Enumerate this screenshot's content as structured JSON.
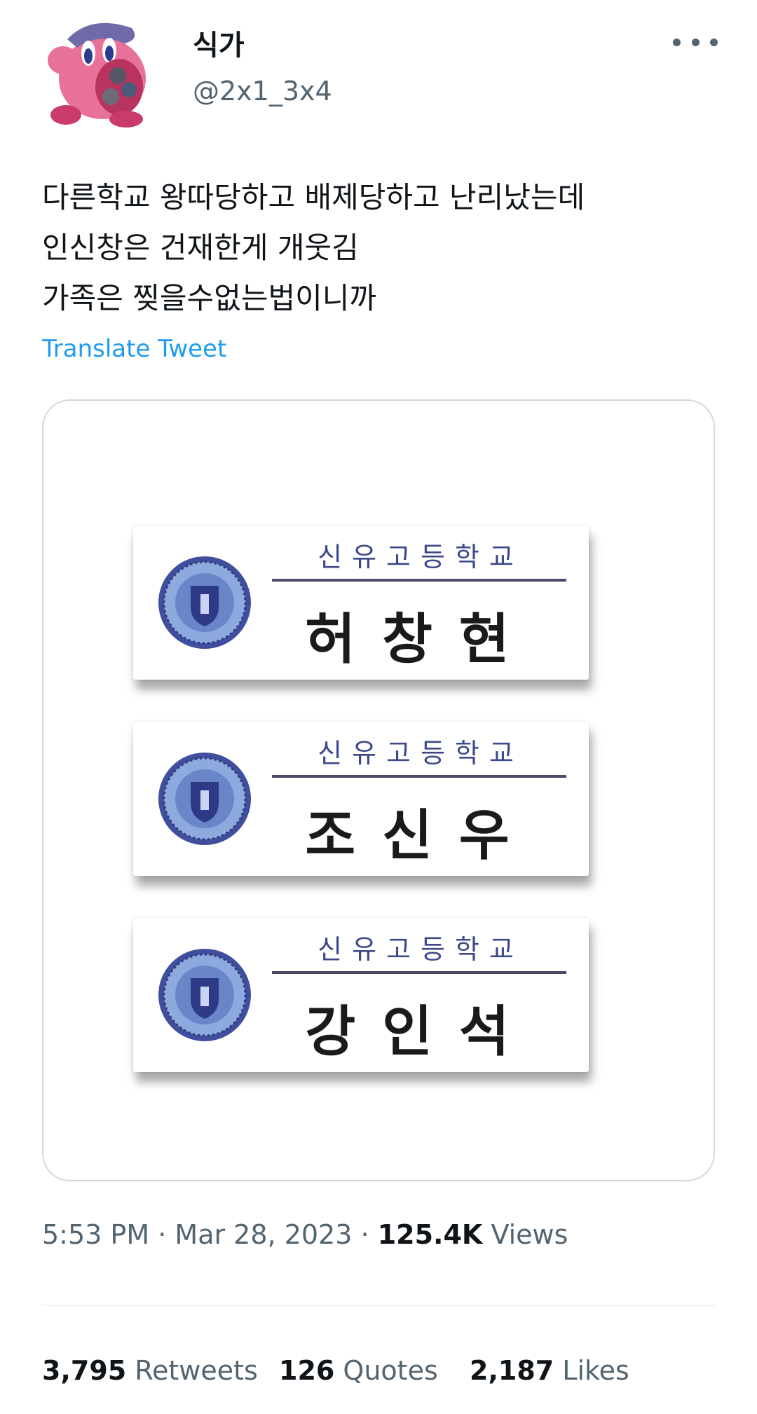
{
  "author": {
    "display_name": "식가",
    "handle": "@2x1_3x4"
  },
  "tweet": {
    "lines": [
      "다른학교 왕따당하고 배제당하고 난리났는데",
      "인신창은 건재한게 개웃김",
      "가족은 찢을수없는법이니까"
    ],
    "translate_label": "Translate Tweet"
  },
  "media": {
    "nametags": [
      {
        "school": "신유고등학교",
        "name": "허창현"
      },
      {
        "school": "신유고등학교",
        "name": "조신우"
      },
      {
        "school": "신유고등학교",
        "name": "강인석"
      }
    ]
  },
  "meta": {
    "time": "5:53 PM",
    "separator": "·",
    "date": "Mar 28, 2023",
    "views_count": "125.4K",
    "views_label": "Views"
  },
  "stats": {
    "retweets_count": "3,795",
    "retweets_label": "Retweets",
    "quotes_count": "126",
    "quotes_label": "Quotes",
    "likes_count": "2,187",
    "likes_label": "Likes"
  },
  "icons": {
    "more": "more-horizontal-icon",
    "avatar": "pink-character-avatar"
  }
}
